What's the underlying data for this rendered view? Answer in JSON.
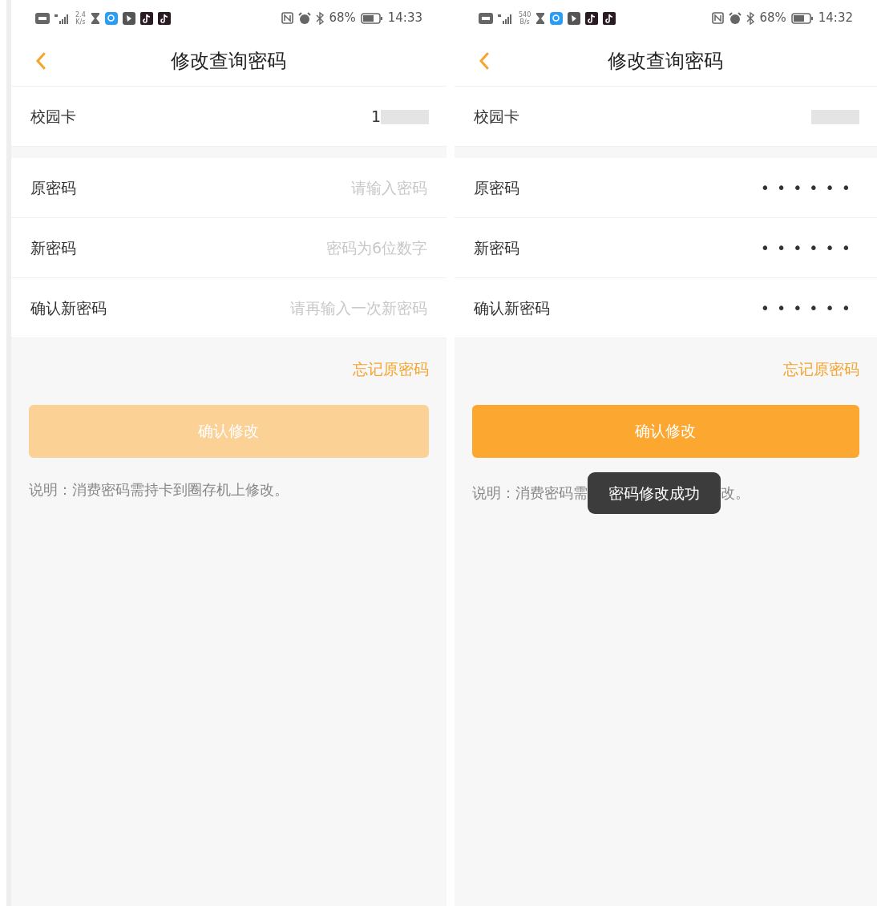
{
  "screens": [
    {
      "status_bar": {
        "net_speed": [
          "2.4",
          "K/s"
        ],
        "battery": "68%",
        "time": "14:33"
      },
      "title": "修改查询密码",
      "card": {
        "label": "校园卡",
        "value": "1"
      },
      "fields": [
        {
          "label": "原密码",
          "placeholder": "请输入密码"
        },
        {
          "label": "新密码",
          "placeholder": "密码为6位数字"
        },
        {
          "label": "确认新密码",
          "placeholder": "请再输入一次新密码"
        }
      ],
      "forgot_link": "忘记原密码",
      "submit": {
        "label": "确认修改",
        "disabled": true
      },
      "note": [
        "说明：消费密码需持卡到圈存机上修改。"
      ]
    },
    {
      "status_bar": {
        "net_speed": [
          "540",
          "B/s"
        ],
        "battery": "68%",
        "time": "14:32"
      },
      "title": "修改查询密码",
      "card": {
        "label": "校园卡"
      },
      "fields": [
        {
          "label": "原密码",
          "value": "••••••"
        },
        {
          "label": "新密码",
          "value": "••••••"
        },
        {
          "label": "确认新密码",
          "value": "••••••"
        }
      ],
      "forgot_link": "忘记原密码",
      "submit": {
        "label": "确认修改",
        "disabled": false
      },
      "note": [
        "说明：消费密码需",
        "改。"
      ],
      "toast": "密码修改成功"
    }
  ]
}
